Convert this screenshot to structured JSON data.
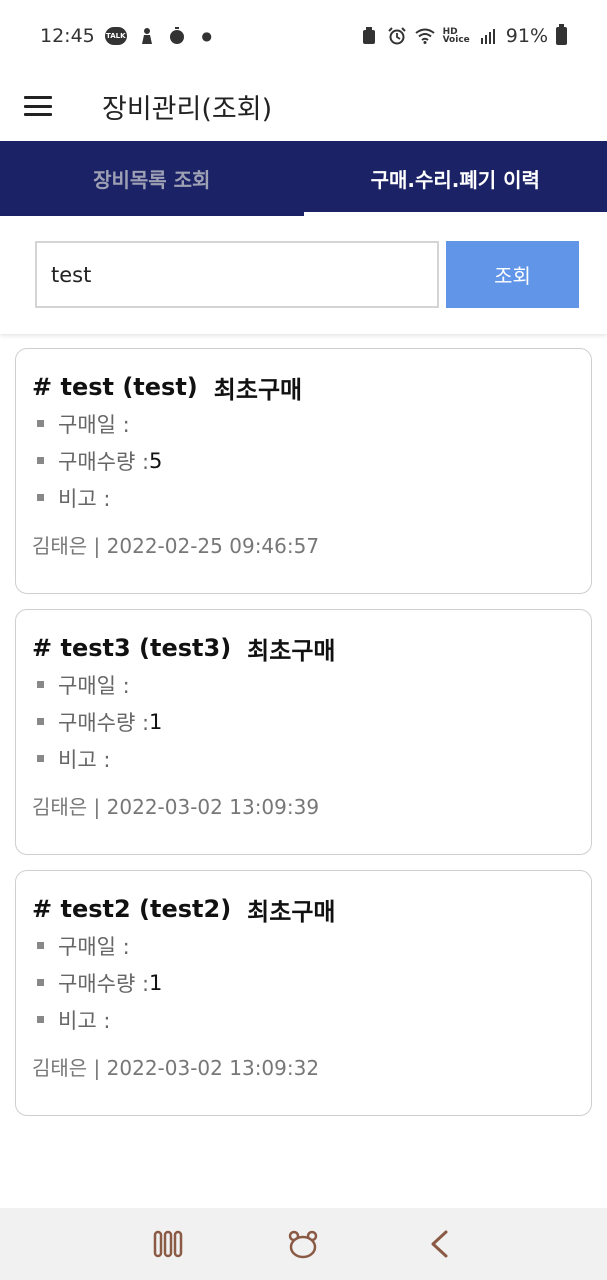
{
  "status_bar": {
    "time": "12:45",
    "talk_badge": "TALK",
    "battery": "91%",
    "hd_top": "HD",
    "hd_bottom": "Voice",
    "icons": [
      "kakaotalk-icon",
      "person-icon",
      "timer-icon",
      "dot-icon",
      "recycle-icon",
      "alarm-icon",
      "wifi-icon",
      "hd-voice-icon",
      "signal-icon",
      "battery-icon"
    ]
  },
  "app_bar": {
    "title": "장비관리(조회)"
  },
  "tabs": [
    {
      "label": "장비목록 조회",
      "active": false
    },
    {
      "label": "구매.수리.폐기 이력",
      "active": true
    }
  ],
  "search": {
    "value": "test",
    "button_label": "조회"
  },
  "labels": {
    "purchase_date": "구매일 :",
    "purchase_qty": "구매수량 :",
    "note": "비고 :"
  },
  "cards": [
    {
      "title": "# test (test)",
      "kind": "최초구매",
      "purchase_date": "",
      "purchase_qty": "5",
      "note": "",
      "footer": "김태은 | 2022-02-25  09:46:57"
    },
    {
      "title": "# test3 (test3)",
      "kind": "최초구매",
      "purchase_date": "",
      "purchase_qty": "1",
      "note": "",
      "footer": "김태은 | 2022-03-02  13:09:39"
    },
    {
      "title": "# test2 (test2)",
      "kind": "최초구매",
      "purchase_date": "",
      "purchase_qty": "1",
      "note": "",
      "footer": "김태은 | 2022-03-02  13:09:32"
    }
  ],
  "nav_bar": {
    "icons": [
      "recent-apps-icon",
      "home-icon",
      "back-icon"
    ]
  }
}
